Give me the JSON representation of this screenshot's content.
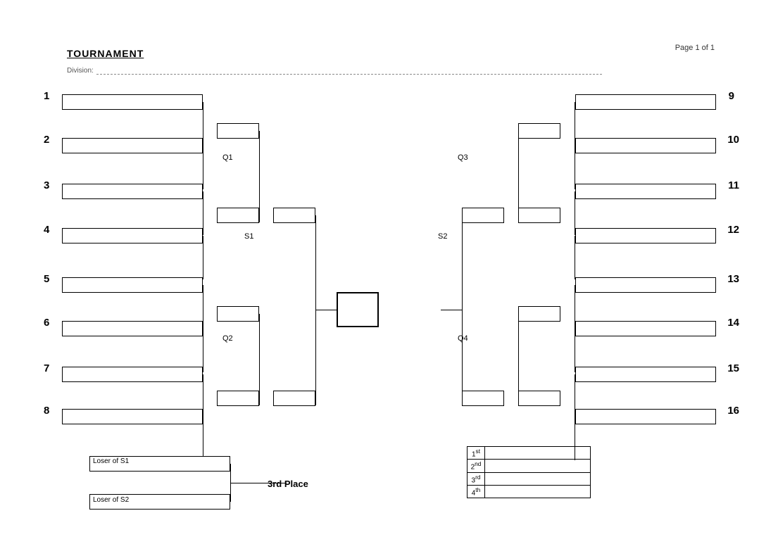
{
  "header": {
    "title": "TOURNAMENT",
    "page_info": "Page 1 of 1",
    "division_label": "Division:"
  },
  "left_seeds": [
    1,
    2,
    3,
    4,
    5,
    6,
    7,
    8
  ],
  "right_seeds": [
    9,
    10,
    11,
    12,
    13,
    14,
    15,
    16
  ],
  "bracket_labels": {
    "Q1": "Q1",
    "Q2": "Q2",
    "Q3": "Q3",
    "Q4": "Q4",
    "S1": "S1",
    "S2": "S2"
  },
  "third_place": {
    "loser_s1": "Loser of S1",
    "loser_s2": "Loser of S2",
    "label": "3rd Place"
  },
  "results": {
    "places": [
      "1st",
      "2nd",
      "3rd",
      "4th"
    ]
  }
}
